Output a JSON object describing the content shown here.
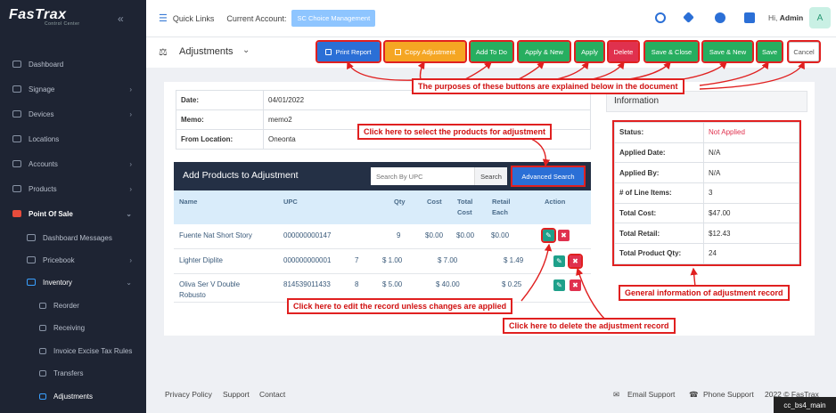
{
  "app": {
    "logo": "FasTrax",
    "logo_sub": "Control Center"
  },
  "sidebar": {
    "items": [
      {
        "label": "Dashboard"
      },
      {
        "label": "Signage"
      },
      {
        "label": "Devices"
      },
      {
        "label": "Locations"
      },
      {
        "label": "Accounts"
      },
      {
        "label": "Products"
      },
      {
        "label": "Point Of Sale"
      },
      {
        "label": "Dashboard Messages"
      },
      {
        "label": "Pricebook"
      },
      {
        "label": "Inventory"
      },
      {
        "label": "Reorder"
      },
      {
        "label": "Receiving"
      },
      {
        "label": "Invoice Excise Tax Rules"
      },
      {
        "label": "Transfers"
      },
      {
        "label": "Adjustments"
      }
    ]
  },
  "topbar": {
    "quick_links": "Quick Links",
    "current_account_label": "Current Account:",
    "current_account": "SC Choice Management",
    "greeting": "Hi,",
    "user": "Admin",
    "avatar": "A"
  },
  "page": {
    "title": "Adjustments"
  },
  "toolbar": {
    "print": "Print Report",
    "copy": "Copy Adjustment",
    "add_todo": "Add To Do",
    "apply_new": "Apply & New",
    "apply": "Apply",
    "delete": "Delete",
    "save_close": "Save & Close",
    "save_new": "Save & New",
    "save": "Save",
    "cancel": "Cancel"
  },
  "record": {
    "date_label": "Date:",
    "date": "04/01/2022",
    "memo_label": "Memo:",
    "memo": "memo2",
    "from_label": "From Location:",
    "from": "Oneonta"
  },
  "info": {
    "heading": "Information",
    "rows": [
      {
        "k": "Status:",
        "v": "Not Applied"
      },
      {
        "k": "Applied Date:",
        "v": "N/A"
      },
      {
        "k": "Applied By:",
        "v": "N/A"
      },
      {
        "k": "# of Line Items:",
        "v": "3"
      },
      {
        "k": "Total Cost:",
        "v": "$47.00"
      },
      {
        "k": "Total Retail:",
        "v": "$12.43"
      },
      {
        "k": "Total Product Qty:",
        "v": "24"
      }
    ],
    "status_color": "#e0314e"
  },
  "products": {
    "heading": "Add Products to Adjustment",
    "search_placeholder": "Search By UPC",
    "search_button": "Search",
    "advanced_search": "Advanced Search",
    "columns": {
      "name": "Name",
      "upc": "UPC",
      "qty": "Qty",
      "cost": "Cost",
      "total_cost_1": "Total",
      "total_cost_2": "Cost",
      "retail_1": "Retail",
      "retail_2": "Each",
      "action": "Action"
    },
    "rows": [
      {
        "name": "Fuente Nat Short Story",
        "name2": "",
        "upc": "000000000147",
        "num": "",
        "qty": "9",
        "cost": "$0.00",
        "total": "$0.00",
        "retail": "$0.00"
      },
      {
        "name": "Lighter Diplite",
        "name2": "",
        "upc": "000000000001",
        "num": "7",
        "qty": "$ 1.00",
        "cost": "",
        "total": "$ 7.00",
        "retail": "$ 1.49"
      },
      {
        "name": "Oliva Ser V Double",
        "name2": "Robusto",
        "upc": "814539011433",
        "num": "8",
        "qty": "$ 5.00",
        "cost": "",
        "total": "$ 40.00",
        "retail": "$ 0.25"
      }
    ]
  },
  "callouts": {
    "buttons": "The purposes of these buttons are explained below in the document",
    "select": "Click here to select the products for adjustment",
    "general": "General information of adjustment record",
    "edit": "Click here to edit the record unless changes are applied",
    "delete": "Click here to delete the adjustment record"
  },
  "footer": {
    "privacy": "Privacy Policy",
    "support": "Support",
    "contact": "Contact",
    "email": "Email Support",
    "phone": "Phone Support",
    "copyright": "2022 © FasTrax",
    "stamp": "cc_bs4_main"
  },
  "colors": {
    "sidebar": "#1e2433",
    "accent": "#e02020",
    "header": "#243045"
  }
}
